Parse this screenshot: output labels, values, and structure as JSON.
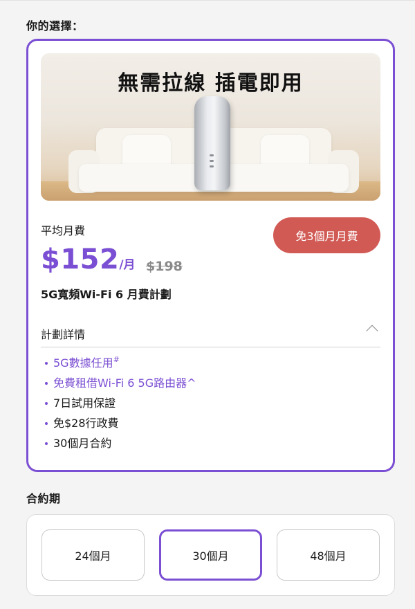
{
  "sections": {
    "choice_title": "你的選擇：",
    "term_title": "合約期"
  },
  "banner": {
    "headline": "無需拉線 插電即用"
  },
  "plan": {
    "avg_label": "平均月費",
    "price": "$152",
    "price_unit": "/月",
    "original_price": "$198",
    "promo_badge": "免3個月月費",
    "name": "5G寬頻Wi-Fi 6 月費計劃",
    "details_title": "計劃詳情",
    "features": [
      {
        "label": "5G數據任用",
        "sup": "#",
        "highlight": true
      },
      {
        "label": "免費租借Wi-Fi 6 5G路由器^",
        "sup": "",
        "highlight": true
      },
      {
        "label": "7日試用保證",
        "sup": "",
        "highlight": false
      },
      {
        "label": "免$28行政費",
        "sup": "",
        "highlight": false
      },
      {
        "label": "30個月合約",
        "sup": "",
        "highlight": false
      }
    ]
  },
  "contract_terms": {
    "options": [
      "24個月",
      "30個月",
      "48個月"
    ],
    "selected": "30個月"
  },
  "colors": {
    "accent": "#7b4fd3",
    "promo": "#d15a55"
  }
}
